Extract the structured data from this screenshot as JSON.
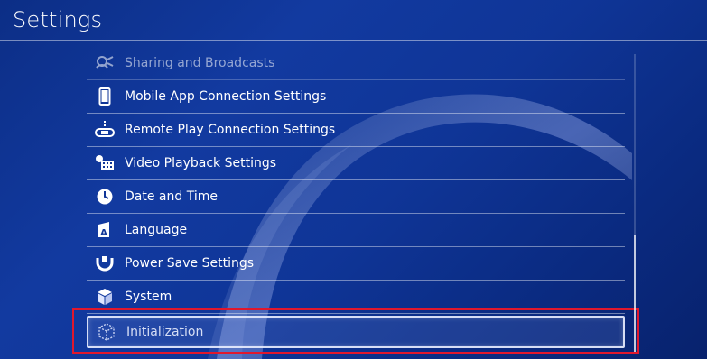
{
  "header": {
    "title": "Settings"
  },
  "menu": {
    "items": [
      {
        "label": "Sharing and Broadcasts",
        "icon": "share-broadcast-icon",
        "state": "faded"
      },
      {
        "label": "Mobile App Connection Settings",
        "icon": "smartphone-icon",
        "state": "normal"
      },
      {
        "label": "Remote Play Connection Settings",
        "icon": "remote-play-icon",
        "state": "normal"
      },
      {
        "label": "Video Playback Settings",
        "icon": "video-playback-icon",
        "state": "normal"
      },
      {
        "label": "Date and Time",
        "icon": "clock-icon",
        "state": "normal"
      },
      {
        "label": "Language",
        "icon": "language-icon",
        "state": "normal"
      },
      {
        "label": "Power Save Settings",
        "icon": "power-save-icon",
        "state": "normal"
      },
      {
        "label": "System",
        "icon": "system-cube-icon",
        "state": "normal"
      },
      {
        "label": "Initialization",
        "icon": "initialization-cube-icon",
        "state": "selected"
      }
    ]
  },
  "colors": {
    "background": "#0f3597",
    "highlight": "#e0182d",
    "text": "#ffffff"
  }
}
